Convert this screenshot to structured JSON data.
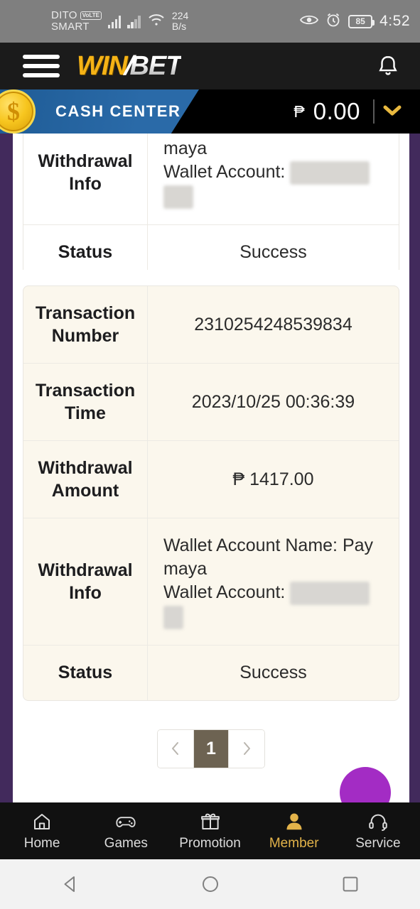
{
  "statusbar": {
    "carrier_line1": "DITO",
    "volte_badge": "VoLTE",
    "carrier_line2": "SMART",
    "network_speed_value": "224",
    "network_speed_unit": "B/s",
    "battery_level": "85",
    "clock": "4:52"
  },
  "header": {
    "menu_icon": "hamburger-menu-icon",
    "logo_part1": "WIN",
    "logo_slash": "/",
    "logo_part2": "BET",
    "notification_icon": "bell-icon"
  },
  "cash_center": {
    "coin_symbol": "$",
    "label": "CASH CENTER",
    "currency_symbol": "₱",
    "balance": "0.00",
    "dropdown_icon": "chevron-down-icon"
  },
  "transactions": [
    {
      "theme": "white",
      "partial_top": true,
      "rows": [
        {
          "key": "Withdrawal Info",
          "value_lines": [
            "maya",
            "Wallet Account:"
          ],
          "redacted": true,
          "align": "left"
        },
        {
          "key": "Status",
          "value": "Success",
          "align": "center"
        }
      ]
    },
    {
      "theme": "cream",
      "partial_top": false,
      "rows": [
        {
          "key": "Transaction Number",
          "value": "2310254248539834",
          "align": "center"
        },
        {
          "key": "Transaction Time",
          "value": "2023/10/25 00:36:39",
          "align": "center"
        },
        {
          "key": "Withdrawal Amount",
          "value": "₱ 1417.00",
          "align": "center"
        },
        {
          "key": "Withdrawal Info",
          "value_lines": [
            "Wallet Account Name: Pay maya",
            "Wallet Account:"
          ],
          "redacted": true,
          "align": "left"
        },
        {
          "key": "Status",
          "value": "Success",
          "align": "center"
        }
      ]
    }
  ],
  "labels": {
    "t1_r1_key": "Withdrawal Info",
    "t1_r1_line1": "maya",
    "t1_r1_line2": "Wallet Account:",
    "t1_r2_key": "Status",
    "t1_r2_value": "Success",
    "t2_r1_key": "Transaction Number",
    "t2_r1_value": "2310254248539834",
    "t2_r2_key": "Transaction Time",
    "t2_r2_value": "2023/10/25 00:36:39",
    "t2_r3_key": "Withdrawal Amount",
    "t2_r3_value": "₱ 1417.00",
    "t2_r4_key": "Withdrawal Info",
    "t2_r4_line1": "Wallet Account Name: Pay maya",
    "t2_r4_line2": "Wallet Account:",
    "t2_r5_key": "Status",
    "t2_r5_value": "Success"
  },
  "pagination": {
    "prev_icon": "chevron-left-icon",
    "current_page": "1",
    "next_icon": "chevron-right-icon"
  },
  "bottom_nav": {
    "items": [
      {
        "label": "Home",
        "icon": "home-icon",
        "active": false
      },
      {
        "label": "Games",
        "icon": "gamepad-icon",
        "active": false
      },
      {
        "label": "Promotion",
        "icon": "gift-icon",
        "active": false
      },
      {
        "label": "Member",
        "icon": "user-icon",
        "active": true
      },
      {
        "label": "Service",
        "icon": "headset-icon",
        "active": false
      }
    ]
  },
  "android_nav": {
    "back_icon": "back-triangle-icon",
    "home_icon": "home-circle-icon",
    "recents_icon": "recents-square-icon"
  },
  "colors": {
    "accent_gold": "#e3b34a",
    "page_purple": "#422a5c",
    "cash_blue": "#2a6aa8",
    "pager_active": "#6d6352",
    "fab_purple": "#a32cc4"
  }
}
